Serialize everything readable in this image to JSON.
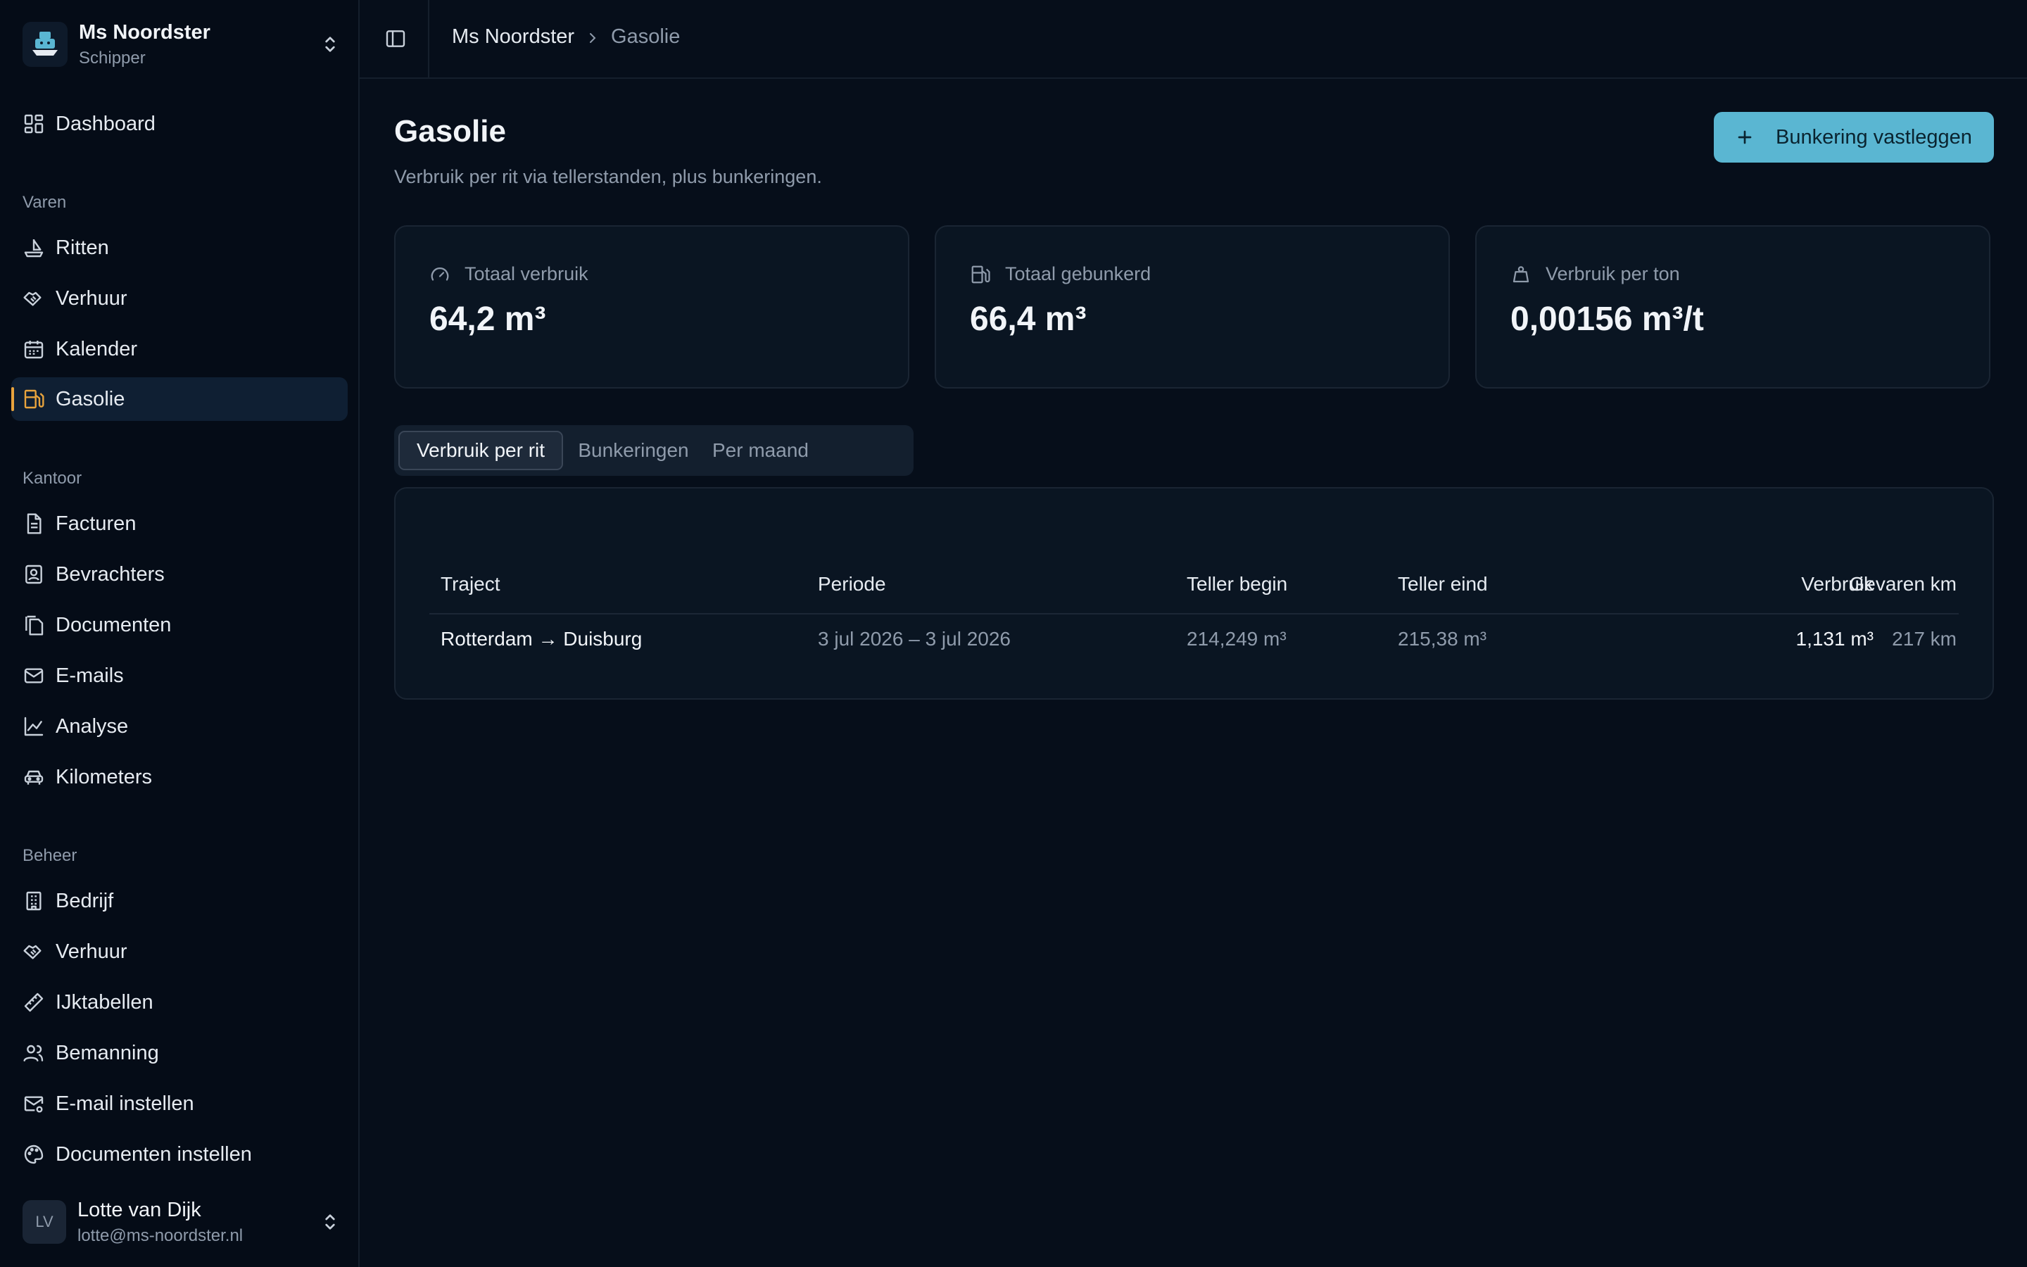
{
  "account": {
    "name": "Ms Noordster",
    "role": "Schipper"
  },
  "nav": {
    "dashboard": "Dashboard",
    "groups": [
      "Varen",
      "Kantoor",
      "Beheer"
    ],
    "varen": [
      {
        "label": "Ritten",
        "icon": "ship-icon"
      },
      {
        "label": "Verhuur",
        "icon": "handshake-icon"
      },
      {
        "label": "Kalender",
        "icon": "calendar-icon"
      },
      {
        "label": "Gasolie",
        "icon": "fuel-icon",
        "active": true
      }
    ],
    "kantoor": [
      {
        "label": "Facturen",
        "icon": "file-text-icon"
      },
      {
        "label": "Bevrachters",
        "icon": "contact-icon"
      },
      {
        "label": "Documenten",
        "icon": "files-icon"
      },
      {
        "label": "E-mails",
        "icon": "mail-icon"
      },
      {
        "label": "Analyse",
        "icon": "line-chart-icon"
      },
      {
        "label": "Kilometers",
        "icon": "car-icon"
      }
    ],
    "beheer": [
      {
        "label": "Bedrijf",
        "icon": "building-icon"
      },
      {
        "label": "Verhuur",
        "icon": "handshake-icon"
      },
      {
        "label": "IJktabellen",
        "icon": "ruler-icon"
      },
      {
        "label": "Bemanning",
        "icon": "users-icon"
      },
      {
        "label": "E-mail instellen",
        "icon": "mail-settings-icon"
      },
      {
        "label": "Documenten instellen",
        "icon": "palette-icon"
      }
    ]
  },
  "user": {
    "initials": "LV",
    "name": "Lotte van Dijk",
    "email": "lotte@ms-noordster.nl"
  },
  "breadcrumb": [
    "Ms Noordster",
    "Gasolie"
  ],
  "page": {
    "title": "Gasolie",
    "subtitle": "Verbruik per rit via tellerstanden, plus bunkeringen.",
    "action": "Bunkering vastleggen"
  },
  "stats": [
    {
      "label": "Totaal verbruik",
      "value": "64,2 m³",
      "icon": "gauge-icon"
    },
    {
      "label": "Totaal gebunkerd",
      "value": "66,4 m³",
      "icon": "fuel-icon"
    },
    {
      "label": "Verbruik per ton",
      "value": "0,00156 m³/t",
      "icon": "weight-icon"
    }
  ],
  "tabs": [
    "Verbruik per rit",
    "Bunkeringen",
    "Per maand"
  ],
  "table": {
    "columns": [
      "Traject",
      "Periode",
      "Teller begin",
      "Teller eind",
      "Verbruik",
      "Gevaren km"
    ],
    "rows": [
      [
        "Rotterdam → Duisburg",
        "3 jul 2026 – 3 jul 2026",
        "214,249 m³",
        "215,38 m³",
        "1,131 m³",
        "217 km"
      ]
    ]
  },
  "colors": {
    "accent": "#5ab6d2",
    "active_marker": "#e8a33d",
    "background": "#060e1a"
  }
}
